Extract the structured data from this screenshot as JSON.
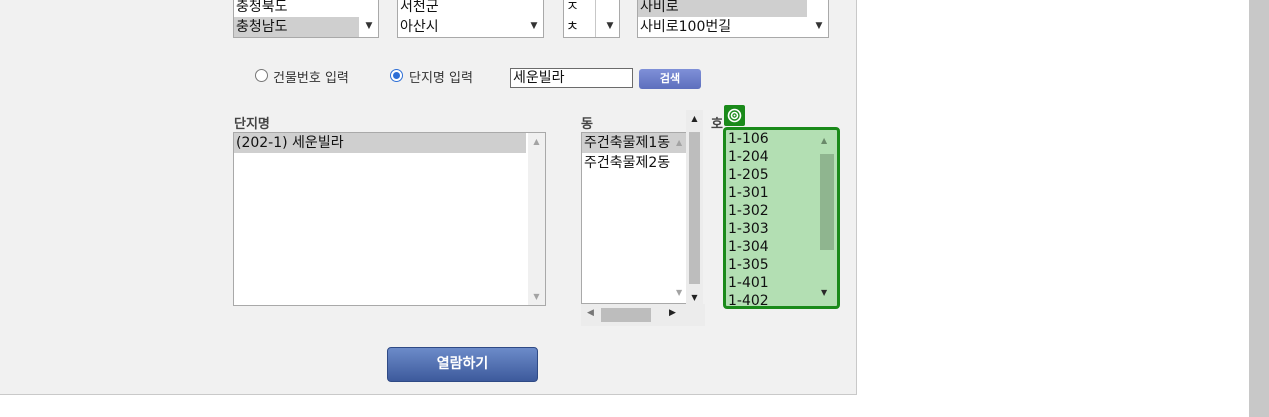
{
  "region": {
    "sido": {
      "options": [
        "충청북도",
        "충청남도"
      ],
      "selected": 1
    },
    "sigungu": {
      "options": [
        "서천군",
        "아산시"
      ]
    },
    "initial": {
      "options": [
        "ㅈ",
        "ㅊ"
      ]
    },
    "road": {
      "options": [
        "사비로",
        "사비로100번길"
      ],
      "selected": 0
    }
  },
  "search_mode": {
    "building_number_label": "건물번호 입력",
    "complex_name_label": "단지명 입력",
    "selected": "complex_name",
    "query_value": "세운빌라",
    "search_button": "검색"
  },
  "complex": {
    "label": "단지명",
    "items": [
      "(202-1) 세운빌라"
    ],
    "selected": 0
  },
  "dong": {
    "label": "동",
    "items": [
      "주건축물제1동",
      "주건축물제2동"
    ],
    "selected": 0
  },
  "ho": {
    "label": "호",
    "items": [
      "1-106",
      "1-204",
      "1-205",
      "1-301",
      "1-302",
      "1-303",
      "1-304",
      "1-305",
      "1-401",
      "1-402"
    ]
  },
  "view_button": "열람하기",
  "colors": {
    "highlight": "#1a8a1a",
    "highlight_fill": "#b3dfb3",
    "button": "#4a67a8"
  }
}
